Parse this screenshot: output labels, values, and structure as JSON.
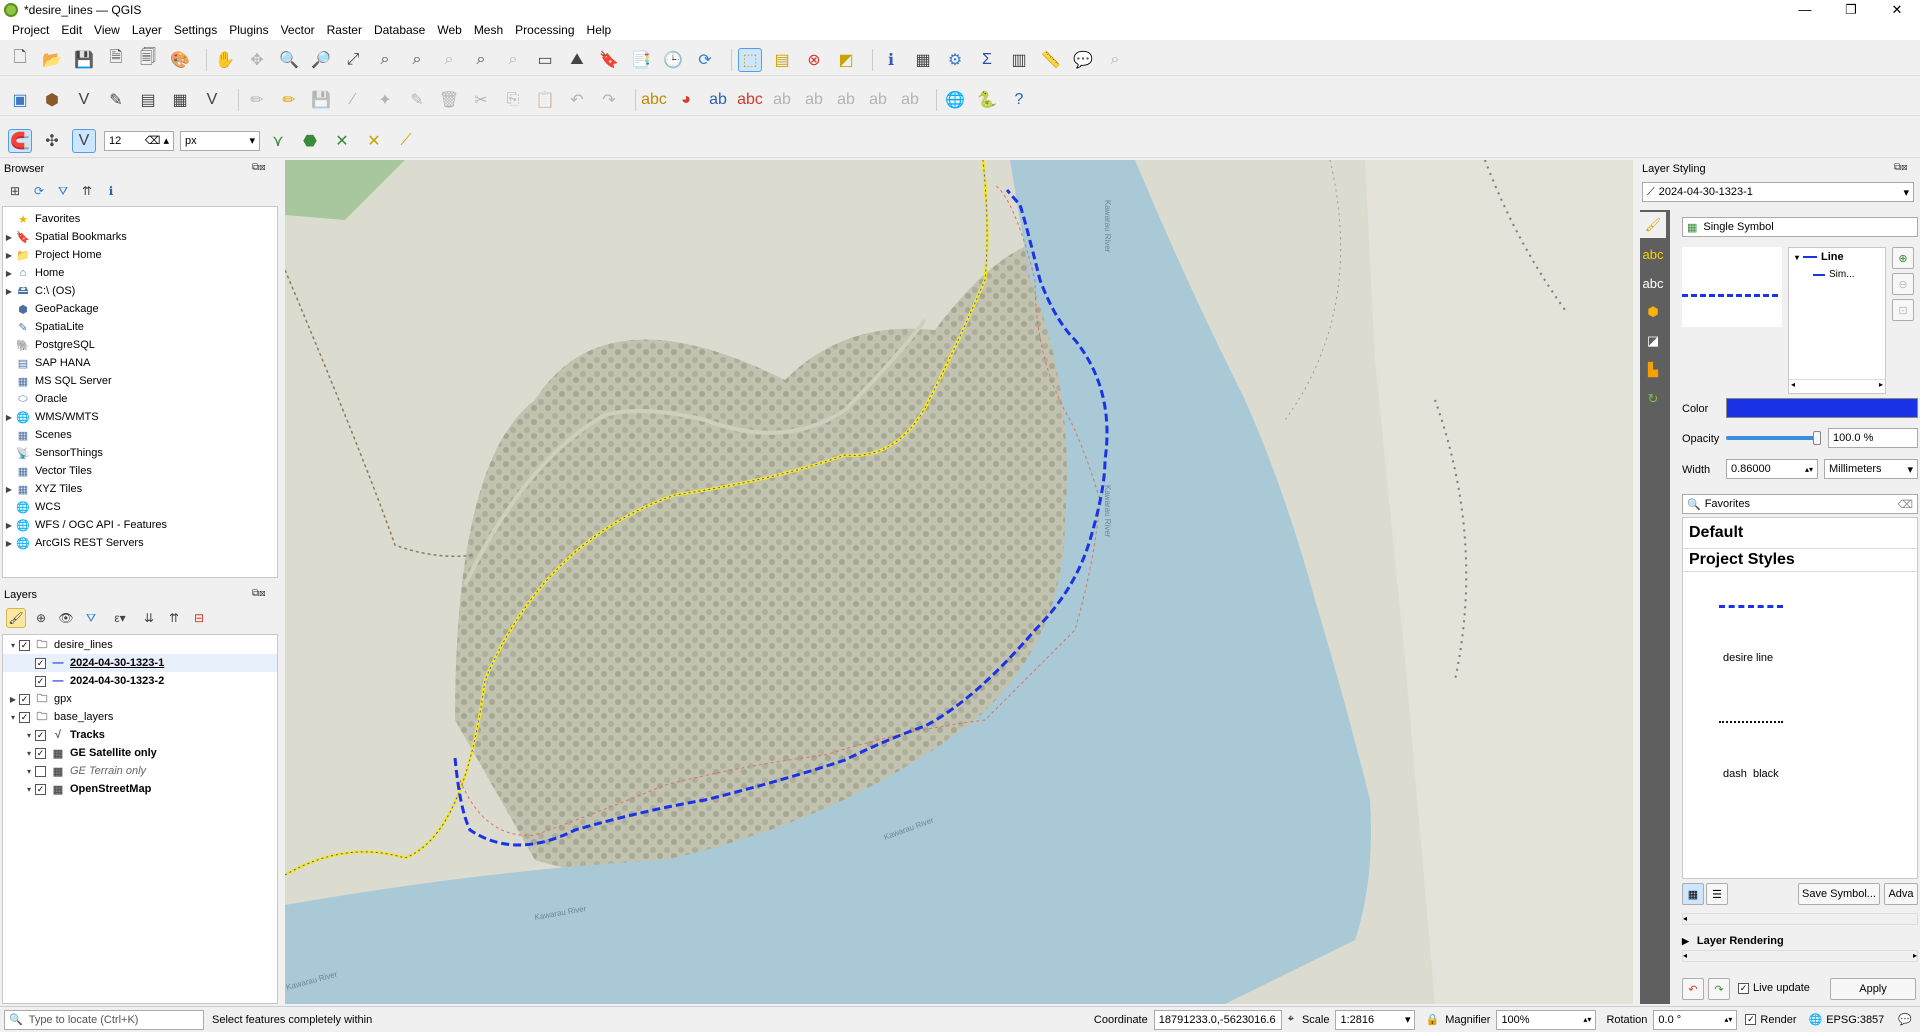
{
  "window": {
    "title": "*desire_lines — QGIS",
    "min": "—",
    "max": "❐",
    "close": "✕"
  },
  "menu": [
    "Project",
    "Edit",
    "View",
    "Layer",
    "Settings",
    "Plugins",
    "Vector",
    "Raster",
    "Database",
    "Web",
    "Mesh",
    "Processing",
    "Help"
  ],
  "snap": {
    "tolerance": "12",
    "unit": "px"
  },
  "browser": {
    "title": "Browser",
    "items": [
      {
        "label": "Favorites",
        "icon": "star-icon",
        "arrow": false
      },
      {
        "label": "Spatial Bookmarks",
        "icon": "bookmark-icon",
        "arrow": true
      },
      {
        "label": "Project Home",
        "icon": "folder-icon",
        "arrow": true
      },
      {
        "label": "Home",
        "icon": "home-icon",
        "arrow": true
      },
      {
        "label": "C:\\ (OS)",
        "icon": "drive-icon",
        "arrow": true
      },
      {
        "label": "GeoPackage",
        "icon": "geopackage-icon",
        "arrow": false
      },
      {
        "label": "SpatiaLite",
        "icon": "spatialite-icon",
        "arrow": false
      },
      {
        "label": "PostgreSQL",
        "icon": "postgresql-icon",
        "arrow": false
      },
      {
        "label": "SAP HANA",
        "icon": "hana-icon",
        "arrow": false
      },
      {
        "label": "MS SQL Server",
        "icon": "mssql-icon",
        "arrow": false
      },
      {
        "label": "Oracle",
        "icon": "oracle-icon",
        "arrow": false
      },
      {
        "label": "WMS/WMTS",
        "icon": "globe-icon",
        "arrow": true
      },
      {
        "label": "Scenes",
        "icon": "scenes-icon",
        "arrow": false
      },
      {
        "label": "SensorThings",
        "icon": "sensor-icon",
        "arrow": false
      },
      {
        "label": "Vector Tiles",
        "icon": "grid-icon",
        "arrow": false
      },
      {
        "label": "XYZ Tiles",
        "icon": "grid-icon",
        "arrow": true
      },
      {
        "label": "WCS",
        "icon": "globe-icon",
        "arrow": false
      },
      {
        "label": "WFS / OGC API - Features",
        "icon": "globe-icon",
        "arrow": true
      },
      {
        "label": "ArcGIS REST Servers",
        "icon": "globe-icon",
        "arrow": true
      }
    ]
  },
  "layers": {
    "title": "Layers",
    "items": [
      {
        "label": "desire_lines",
        "level": 0,
        "checked": true,
        "expanded": true,
        "bold": false,
        "group": true
      },
      {
        "label": "2024-04-30-1323-1",
        "level": 1,
        "checked": true,
        "bold": true,
        "underline": true,
        "selected": true
      },
      {
        "label": "2024-04-30-1323-2",
        "level": 1,
        "checked": true,
        "bold": true
      },
      {
        "label": "gpx",
        "level": 0,
        "checked": true,
        "expanded": false,
        "group": true
      },
      {
        "label": "base_layers",
        "level": 0,
        "checked": true,
        "expanded": true,
        "group": true
      },
      {
        "label": "Tracks",
        "level": 1,
        "checked": true,
        "bold": true
      },
      {
        "label": "GE Satellite only",
        "level": 1,
        "checked": true,
        "bold": true
      },
      {
        "label": "GE Terrain only",
        "level": 1,
        "checked": false,
        "italic": true
      },
      {
        "label": "OpenStreetMap",
        "level": 1,
        "checked": true,
        "bold": true
      }
    ]
  },
  "map_labels": [
    "Kawarau River",
    "Kawarau River",
    "Kawarau River",
    "Kawarau River",
    "Kawarau River"
  ],
  "styling": {
    "title": "Layer Styling",
    "layer": "2024-04-30-1323-1",
    "renderer": "Single Symbol",
    "tree_line": "Line",
    "tree_sim": "Sim...",
    "color_label": "Color",
    "color_value": "#1a33e6",
    "opacity_label": "Opacity",
    "opacity_value": "100.0 %",
    "opacity_level": 1.0,
    "width_label": "Width",
    "width_value": "0.86000",
    "width_unit": "Millimeters",
    "search": "Favorites",
    "group_default": "Default",
    "group_project": "Project Styles",
    "symbols": [
      "desire line",
      "dash  black"
    ],
    "save_symbol": "Save Symbol...",
    "advanced": "Adva",
    "layer_rendering": "Layer Rendering",
    "live_update": "Live update",
    "apply": "Apply"
  },
  "status": {
    "locate_placeholder": "Type to locate (Ctrl+K)",
    "message": "Select features completely within",
    "coord_label": "Coordinate",
    "coord_value": "18791233.0,-5623016.6",
    "scale_label": "Scale",
    "scale_value": "1:2816",
    "magnifier_label": "Magnifier",
    "magnifier_value": "100%",
    "rotation_label": "Rotation",
    "rotation_value": "0.0 °",
    "render_label": "Render",
    "crs": "EPSG:3857"
  }
}
